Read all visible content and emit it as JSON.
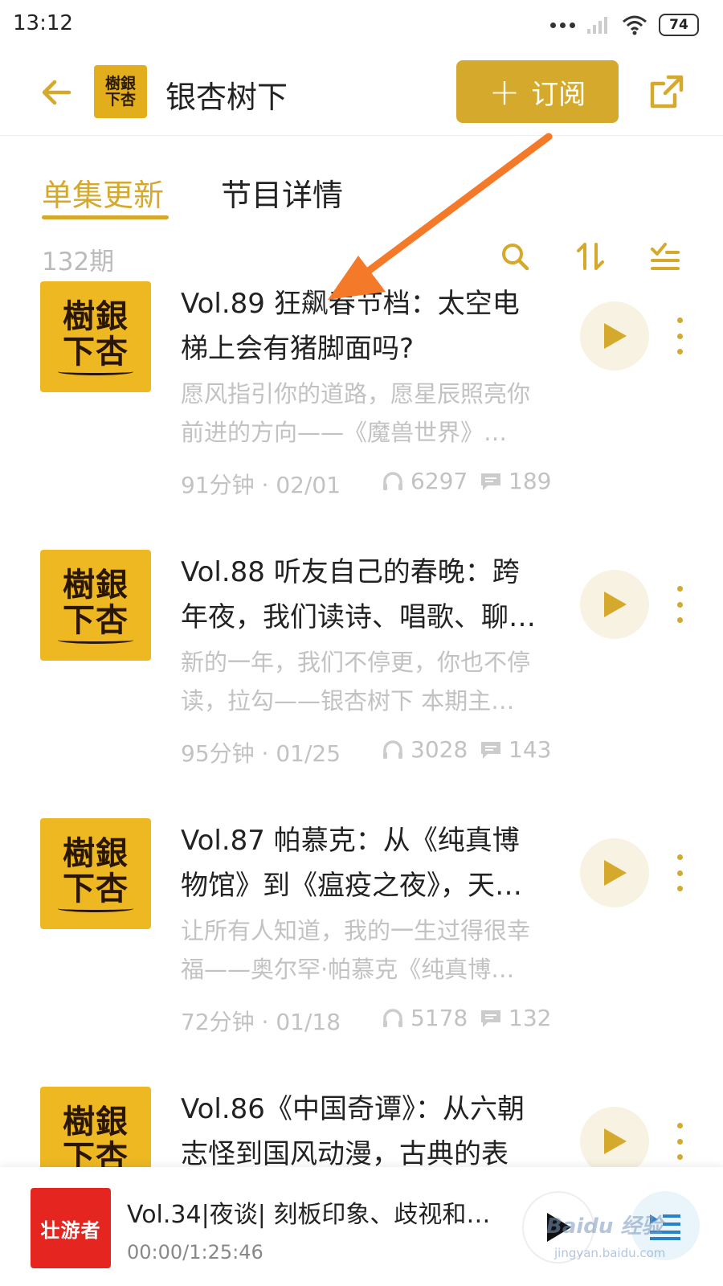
{
  "status_bar": {
    "time": "13:12",
    "battery": "74"
  },
  "header": {
    "title": "银杏树下",
    "subscribe_label": "订阅",
    "logo_text": "樹銀\n下杏"
  },
  "tabs": [
    {
      "label": "单集更新"
    },
    {
      "label": "节目详情"
    }
  ],
  "list": {
    "count": "132期"
  },
  "episodes": [
    {
      "cover_text": "樹銀\n下杏",
      "title": "Vol.89 狂飙春节档：太空电梯上会有猪脚面吗?",
      "desc": "愿风指引你的道路，愿星辰照亮你前进的方向——《魔兽世界》…",
      "duration_date": "91分钟 · 02/01",
      "plays": "6297",
      "comments": "189"
    },
    {
      "cover_text": "樹銀\n下杏",
      "title": "Vol.88 听友自己的春晚：跨年夜，我们读诗、唱歌、聊…",
      "desc": "新的一年，我们不停更，你也不停读，拉勾——银杏树下 本期主…",
      "duration_date": "95分钟 · 01/25",
      "plays": "3028",
      "comments": "143"
    },
    {
      "cover_text": "樹銀\n下杏",
      "title": "Vol.87 帕慕克：从《纯真博物馆》到《瘟疫之夜》，天…",
      "desc": "让所有人知道，我的一生过得很幸福——奥尔罕·帕慕克《纯真博…",
      "duration_date": "72分钟 · 01/18",
      "plays": "5178",
      "comments": "132"
    },
    {
      "cover_text": "樹銀\n下杏",
      "title": "Vol.86《中国奇谭》：从六朝志怪到国风动漫，古典的表",
      "desc": "",
      "duration_date": "",
      "plays": "",
      "comments": ""
    }
  ],
  "player": {
    "cover_text": "壮游者",
    "title": "Vol.34|夜谈| 刻板印象、歧视和…",
    "time": "00:00/1:25:46"
  },
  "watermark": {
    "text": "Baidu 经验",
    "url": "jingyan.baidu.com"
  },
  "colors": {
    "accent": "#d5a92b",
    "annotation_arrow": "#f47a2a",
    "cover": "#edb821",
    "player_cover": "#e52520"
  }
}
